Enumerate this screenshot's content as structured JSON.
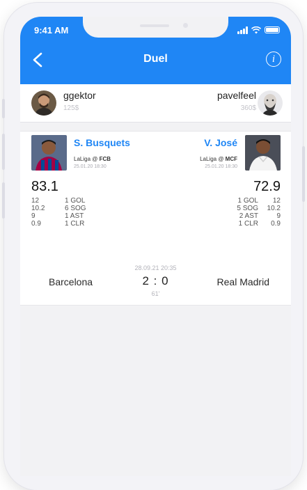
{
  "status_bar": {
    "time": "9:41 AM"
  },
  "nav": {
    "title": "Duel"
  },
  "users": {
    "left": {
      "name": "ggektor",
      "money": "125$"
    },
    "right": {
      "name": "pavelfeel",
      "money": "360$"
    }
  },
  "players": {
    "left": {
      "name": "S. Busquets",
      "league_prefix": "LaLiga @ ",
      "league_team": "FCB",
      "date": "25.01.20 18:30",
      "score": "83.1",
      "stats": [
        {
          "value": "12",
          "label": "1 GOL"
        },
        {
          "value": "10.2",
          "label": "6 SOG"
        },
        {
          "value": "9",
          "label": "1 AST"
        },
        {
          "value": "0.9",
          "label": "1 CLR"
        }
      ]
    },
    "right": {
      "name": "V. José",
      "league_prefix": "LaLiga @ ",
      "league_team": "MCF",
      "date": "25.01.20 18:30",
      "score": "72.9",
      "stats": [
        {
          "value": "12",
          "label": "1 GOL"
        },
        {
          "value": "10.2",
          "label": "5 SOG"
        },
        {
          "value": "9",
          "label": "2 AST"
        },
        {
          "value": "0.9",
          "label": "1 CLR"
        }
      ]
    }
  },
  "match": {
    "datetime": "28.09.21 20:35",
    "home": "Barcelona",
    "away": "Real Madrid",
    "score": "2 : 0",
    "minute": "61'"
  },
  "colors": {
    "accent": "#1f86f5",
    "background": "#f2f2f4"
  }
}
